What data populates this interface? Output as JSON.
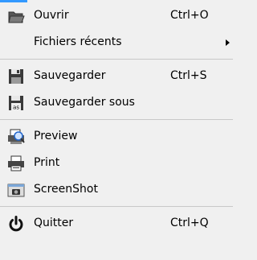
{
  "menu": {
    "open": {
      "label": "Ouvrir",
      "shortcut": "Ctrl+O",
      "icon": "folder-open-icon"
    },
    "recent": {
      "label": "Fichiers récents",
      "icon": "submenu-arrow-icon"
    },
    "save": {
      "label": "Sauvegarder",
      "shortcut": "Ctrl+S",
      "icon": "floppy-disk-icon"
    },
    "save_as": {
      "label": "Sauvegarder sous",
      "icon": "floppy-disk-as-icon"
    },
    "preview": {
      "label": "Preview",
      "icon": "print-preview-icon"
    },
    "print": {
      "label": "Print",
      "icon": "printer-icon"
    },
    "screenshot": {
      "label": "ScreenShot",
      "icon": "camera-icon"
    },
    "quit": {
      "label": "Quitter",
      "shortcut": "Ctrl+Q",
      "icon": "power-icon"
    }
  },
  "colors": {
    "background": "#f0f0f0",
    "separator": "#c8c8c8",
    "accent": "#3399ff"
  }
}
